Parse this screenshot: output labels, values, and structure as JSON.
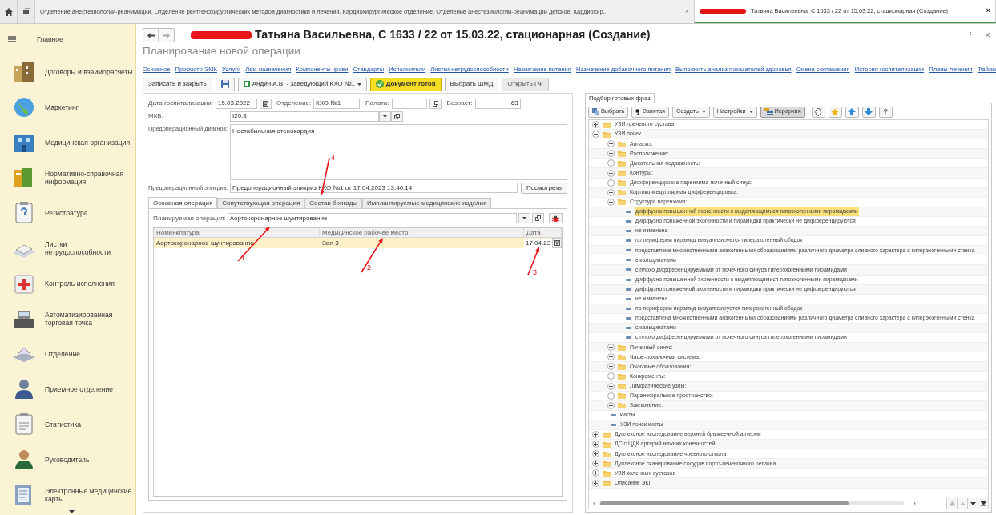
{
  "top_tabs": [
    {
      "label": "Отделение анестезиологии-реанимации, Отделение рентгенохирургических методов диагностики и лечения, Кардиохирургическое отделение, Отделение анестезиологии-реанимации детское, Кардиохир...",
      "close": "×",
      "selected": false
    },
    {
      "label": "Татьяна Васильевна, С 1633 / 22 от 15.03.22, стационарная (Создание)",
      "close": "×",
      "selected": true
    }
  ],
  "sidebar": {
    "items": [
      {
        "label": "Главное"
      },
      {
        "label": "Договоры и взаиморасчеты"
      },
      {
        "label": "Маркетинг"
      },
      {
        "label": "Медицинская организация"
      },
      {
        "label": "Нормативно-справочная информация"
      },
      {
        "label": "Регистратура"
      },
      {
        "label": "Листки нетрудоспособности"
      },
      {
        "label": "Контроль исполнения"
      },
      {
        "label": "Автоматизированная торговая точка"
      },
      {
        "label": "Отделение"
      },
      {
        "label": "Приемное отделение"
      },
      {
        "label": "Статистика"
      },
      {
        "label": "Руководитель"
      },
      {
        "label": "Электронные медицинские карты"
      }
    ]
  },
  "window": {
    "title": "Татьяна Васильевна, С 1633 / 22 от 15.03.22, стационарная (Создание)",
    "subtitle": "Планирование новой операции",
    "more": "⋮",
    "close": "×"
  },
  "links": [
    "Основное",
    "Просмотр ЭМК",
    "Услуги",
    "Лек. назначения",
    "Компоненты крови",
    "Стандарты",
    "Исполнители",
    "Листки нетрудоспособности",
    "Назначение питания",
    "Назначение добавочного питания",
    "Выполнить анализ показателей здоровья",
    "Смена соглашения",
    "История госпитализации",
    "Планы лечения",
    "Файлы"
  ],
  "toolbar": [
    {
      "kind": "button",
      "label": "Записать и закрыть"
    },
    {
      "kind": "save"
    },
    {
      "kind": "dropdown",
      "label": "Андин А.В. - заведующий КХО №1"
    },
    {
      "kind": "primary",
      "label": "Документ готов"
    },
    {
      "kind": "button",
      "label": "Выбрать ШМД"
    },
    {
      "kind": "muted",
      "label": "Открыть ГФ"
    }
  ],
  "form": {
    "hosp_date": {
      "label": "Дата госпитализации:",
      "value": "15.03.2022"
    },
    "department": {
      "label": "Отделение:",
      "value": "КХО №1"
    },
    "ward": {
      "label": "Палата:"
    },
    "age": {
      "label": "Возраст:",
      "value": "63"
    },
    "icd": {
      "label": "МКБ:",
      "value": "I20.8"
    },
    "diagnosis": {
      "label": "Предоперационный диагноз:",
      "value": "Нестабильная стенокардия"
    },
    "epicrisis": {
      "label": "Предоперационный эпикриз:",
      "value": "Предоперационный эпикриз КХО №1 от 17.04.2023 13:40:14",
      "button": "Посмотреть"
    }
  },
  "tabs": [
    {
      "label": "Основная операция",
      "selected": true
    },
    {
      "label": "Сопутствующая операция",
      "selected": false
    },
    {
      "label": "Состав бригады",
      "selected": false
    },
    {
      "label": "Имплантируемые медицинские изделия",
      "selected": false
    }
  ],
  "planned_operation": {
    "label": "Планируемая операция:",
    "value": "Аортокоронарное шунтирование"
  },
  "table": {
    "columns": [
      "Номенклатура",
      "Медицинское рабочее место",
      "Дата"
    ],
    "rows": [
      {
        "cells": [
          "Аортокоронарное шунтирование",
          "Зал 3",
          "17.04.23"
        ],
        "selected": true
      }
    ]
  },
  "annotations": [
    {
      "label": "1"
    },
    {
      "label": "2"
    },
    {
      "label": "3"
    },
    {
      "label": "4"
    }
  ],
  "phrases": {
    "tab": "Подбор готовых фраз",
    "toolbar": [
      {
        "kind": "select",
        "label": "Выбрать",
        "pressed": false
      },
      {
        "kind": "comma",
        "label": "Запятая",
        "pressed": false
      },
      {
        "kind": "menu",
        "label": "Создать",
        "pressed": false
      },
      {
        "kind": "menu",
        "label": "Настройки",
        "pressed": false
      },
      {
        "kind": "hierarchy",
        "label": "Иерархия",
        "pressed": true
      },
      {
        "kind": "link",
        "pressed": false
      },
      {
        "kind": "star",
        "pressed": false
      },
      {
        "kind": "up",
        "pressed": false
      },
      {
        "kind": "down",
        "pressed": false
      },
      {
        "kind": "help",
        "label": "?",
        "pressed": false
      }
    ],
    "tree": [
      {
        "kind": "folder",
        "label": "УЗИ плечевого сустава",
        "expanded": false,
        "selected": false
      },
      {
        "kind": "folder",
        "label": "УЗИ почек",
        "expanded": true,
        "selected": false,
        "children": [
          {
            "kind": "folder",
            "label": "Аппарат:",
            "expanded": false,
            "selected": false
          },
          {
            "kind": "folder",
            "label": "Расположение:",
            "expanded": false,
            "selected": false
          },
          {
            "kind": "folder",
            "label": "Дыхательная подвижность:",
            "expanded": false,
            "selected": false
          },
          {
            "kind": "folder",
            "label": "Контуры:",
            "expanded": false,
            "selected": false
          },
          {
            "kind": "folder",
            "label": "Дифференцировка паренхима-почечный синус:",
            "expanded": false,
            "selected": false
          },
          {
            "kind": "folder",
            "label": "Кортико-медуллярная дифференцировка:",
            "expanded": false,
            "selected": false
          },
          {
            "kind": "folder",
            "label": "Структура паренхима:",
            "expanded": true,
            "selected": false,
            "children": [
              {
                "kind": "phrase",
                "label": "диффузно повышенной эхогенности с выделяющимися гипоэхогенными пирамидками",
                "selected": true
              },
              {
                "kind": "phrase",
                "label": "диффузно пониженной эхогенности и пирамидки практически не дифференцируются",
                "selected": false
              },
              {
                "kind": "phrase",
                "label": "не изменена",
                "selected": false
              },
              {
                "kind": "phrase",
                "label": "по периферии пирамид визуализируется гиперэхогенный ободок",
                "selected": false
              },
              {
                "kind": "phrase",
                "label": "представлена множественными анэхогенными образованиями различного диаметра сливного характера с гиперэхогенными стенка",
                "selected": false
              },
              {
                "kind": "phrase",
                "label": "с кальцинатами",
                "selected": false
              },
              {
                "kind": "phrase",
                "label": "с плохо дифференцируемыми от почечного синуса гиперэхогенными пирамидами",
                "selected": false
              },
              {
                "kind": "phrase",
                "label": "диффузно повышенной эхогенности с выделяющимися гипоэхогенными пирамидками",
                "selected": false
              },
              {
                "kind": "phrase",
                "label": "диффузно пониженной эхогенности и пирамидки практически не дифференцируются",
                "selected": false
              },
              {
                "kind": "phrase",
                "label": "не изменена",
                "selected": false
              },
              {
                "kind": "phrase",
                "label": "по периферии пирамид визуализируется гиперэхогенный ободок",
                "selected": false
              },
              {
                "kind": "phrase",
                "label": "представлена множественными анэхогенными образованиями различного диаметра сливного характера с гиперэхогенными стенка",
                "selected": false
              },
              {
                "kind": "phrase",
                "label": "с кальцинатами",
                "selected": false
              },
              {
                "kind": "phrase",
                "label": "с плохо дифференцируемыми от почечного синуса гиперэхогенными пирамидами",
                "selected": false
              }
            ]
          },
          {
            "kind": "folder",
            "label": "Почечный синус:",
            "expanded": false,
            "selected": false
          },
          {
            "kind": "folder",
            "label": "Чаше-лоханочная система:",
            "expanded": false,
            "selected": false
          },
          {
            "kind": "folder",
            "label": "Очаговые образования:",
            "expanded": false,
            "selected": false
          },
          {
            "kind": "folder",
            "label": "Конкременты:",
            "expanded": false,
            "selected": false
          },
          {
            "kind": "folder",
            "label": "Лимфатические узлы:",
            "expanded": false,
            "selected": false
          },
          {
            "kind": "folder",
            "label": "Паранефральное пространство:",
            "expanded": false,
            "selected": false
          },
          {
            "kind": "folder",
            "label": "Заключение:",
            "expanded": false,
            "selected": false
          },
          {
            "kind": "phrase",
            "label": "кисты",
            "selected": false
          },
          {
            "kind": "phrase",
            "label": "УЗИ почек кисты",
            "selected": false
          }
        ]
      },
      {
        "kind": "folder",
        "label": "Дуплексное исследование верхней брыжеечной артерии",
        "expanded": false,
        "selected": false
      },
      {
        "kind": "folder",
        "label": "ДС с ЦДК артерий нижних конечностей",
        "expanded": false,
        "selected": false
      },
      {
        "kind": "folder",
        "label": "Дуплексное исследование чревного ствола",
        "expanded": false,
        "selected": false
      },
      {
        "kind": "folder",
        "label": "Дуплексное сканирование сосудов порто-печеночного региона",
        "expanded": false,
        "selected": false
      },
      {
        "kind": "folder",
        "label": "УЗИ коленных суставов",
        "expanded": false,
        "selected": false
      },
      {
        "kind": "folder",
        "label": "Описание ЭКГ",
        "expanded": false,
        "selected": false
      }
    ]
  }
}
